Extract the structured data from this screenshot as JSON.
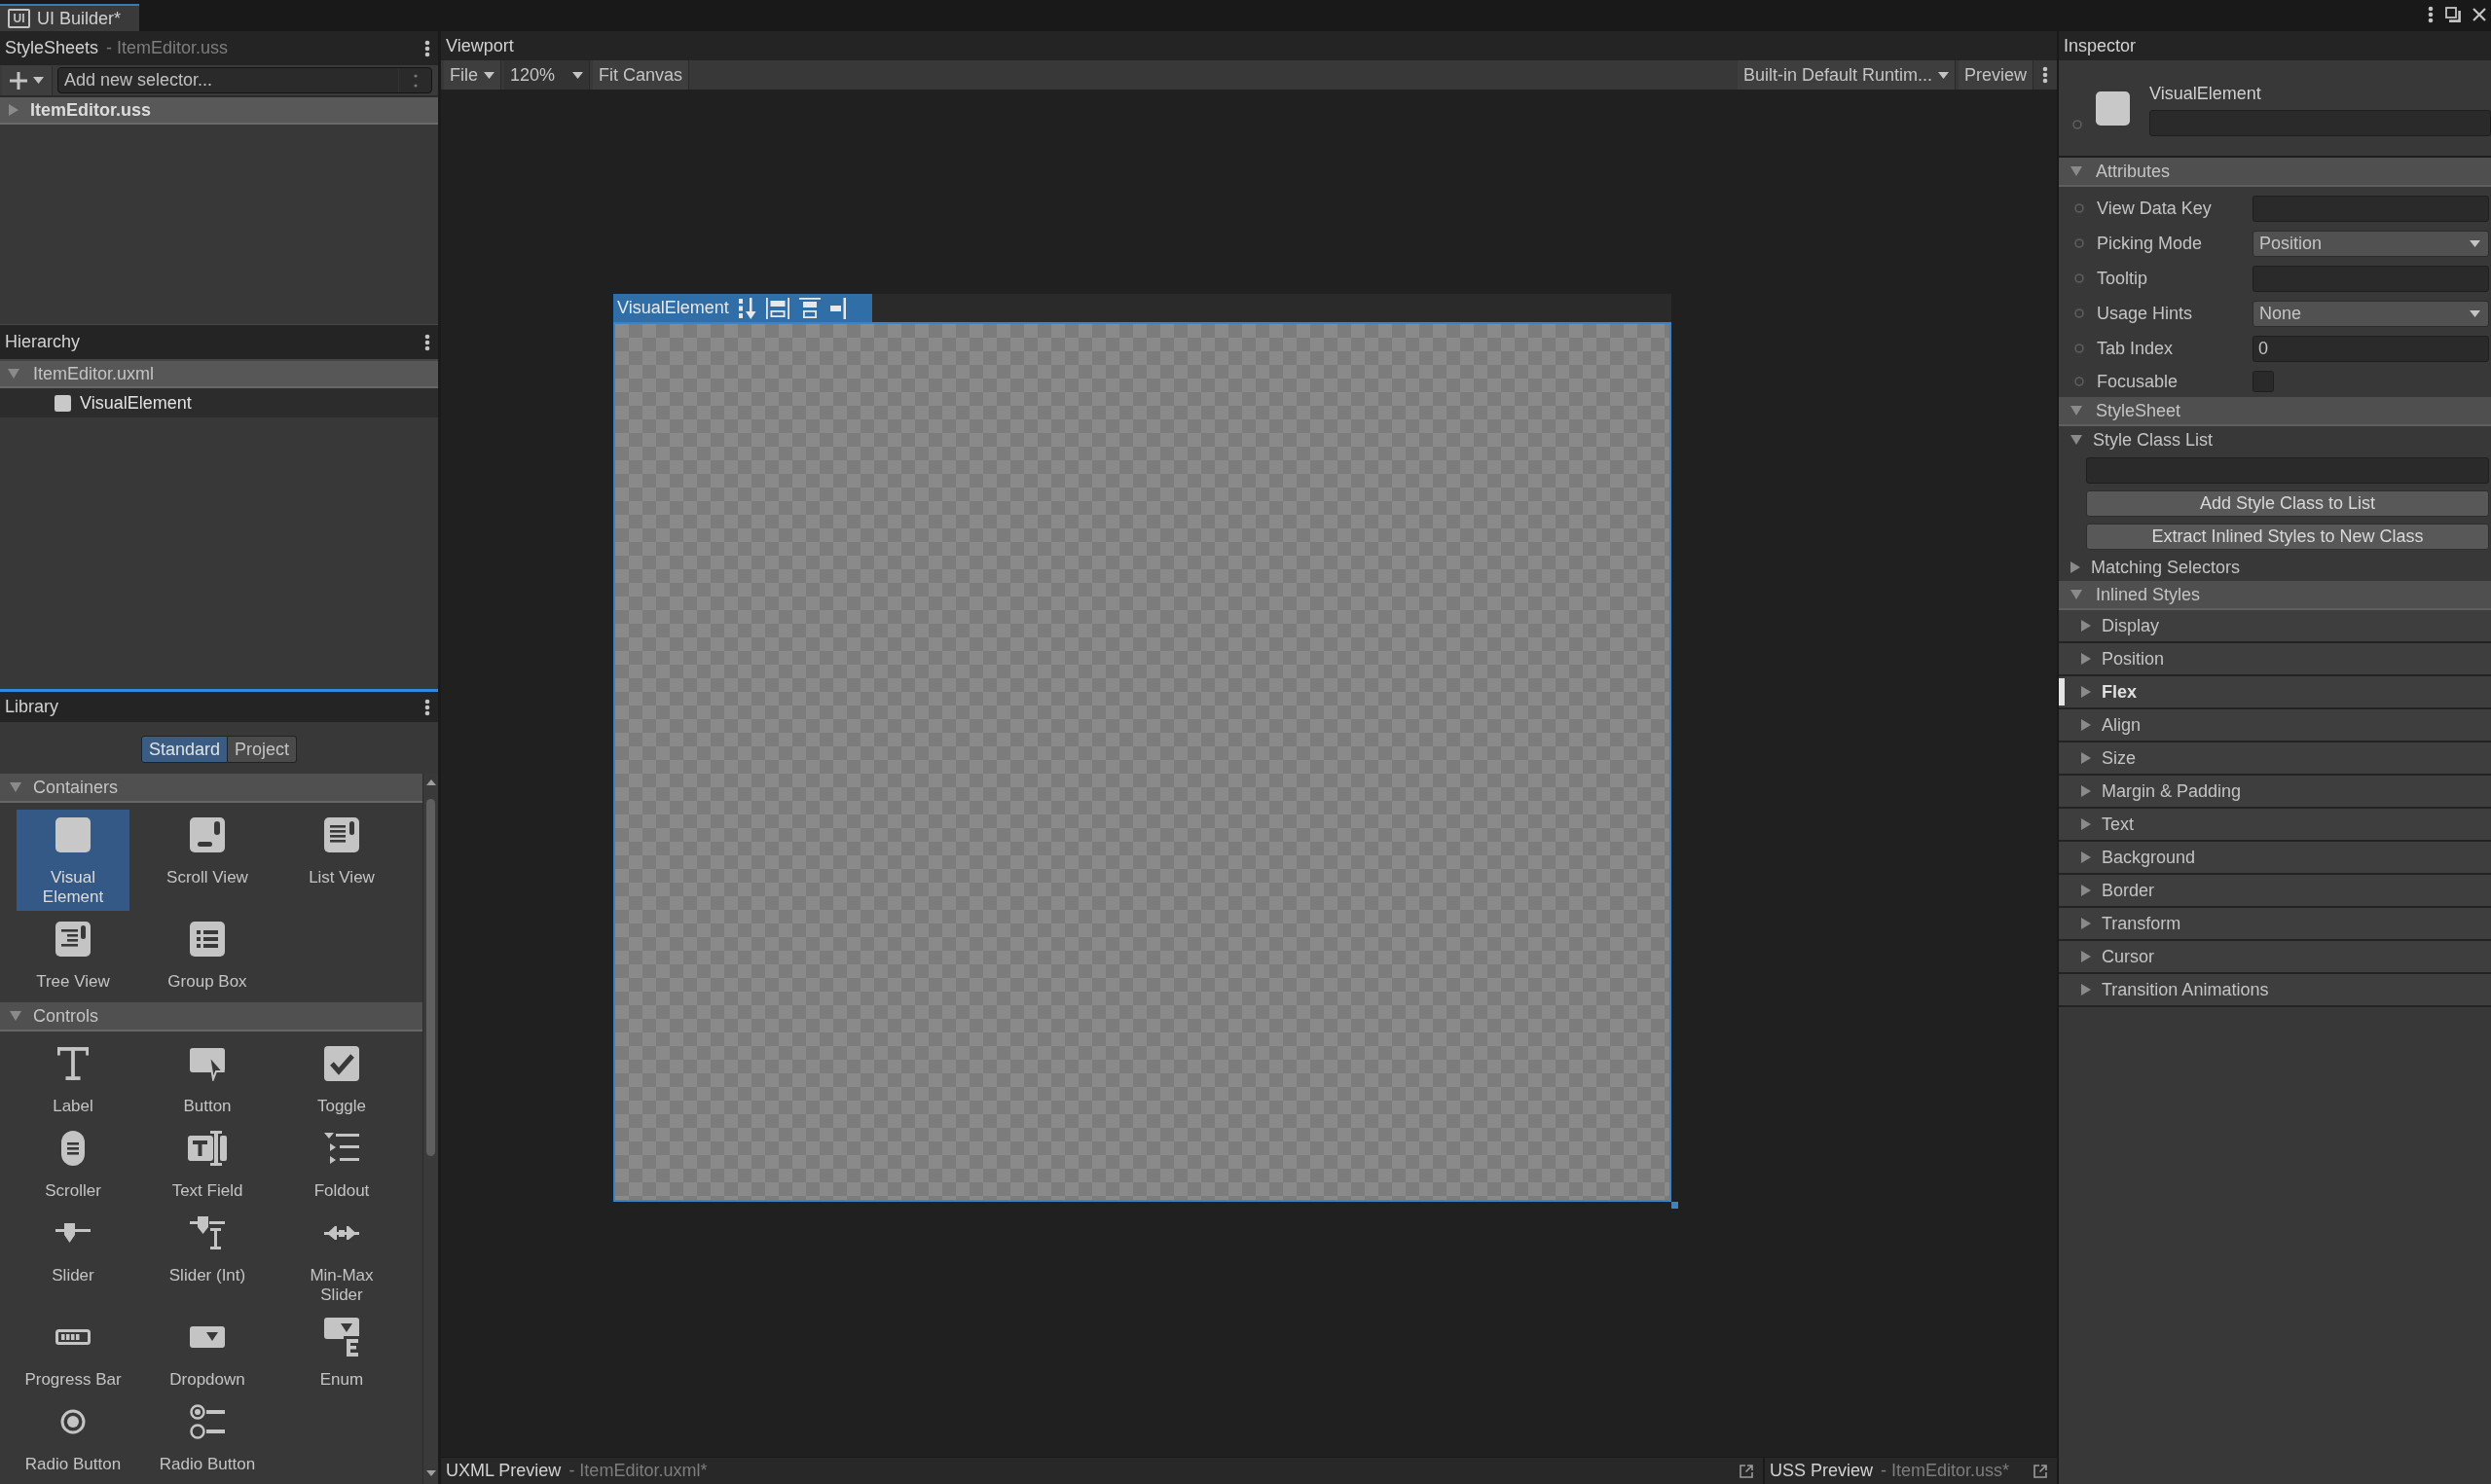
{
  "window": {
    "logo_text": "UI",
    "tab_title": "UI Builder*"
  },
  "stylesheets": {
    "title": "StyleSheets",
    "subtitle": "- ItemEditor.uss",
    "selector_field": {
      "placeholder": "Add new selector..."
    },
    "items": [
      {
        "label": "ItemEditor.uss",
        "expanded": false
      }
    ]
  },
  "hierarchy": {
    "title": "Hierarchy",
    "items": [
      {
        "label": "ItemEditor.uxml",
        "expanded": true,
        "children": [
          {
            "label": "VisualElement",
            "selected": true
          }
        ]
      }
    ]
  },
  "library": {
    "title": "Library",
    "tabs": [
      {
        "label": "Standard",
        "selected": true
      },
      {
        "label": "Project",
        "selected": false
      }
    ],
    "sections": [
      {
        "title": "Containers",
        "expanded": true,
        "items": [
          {
            "label": "Visual Element",
            "kind": "visual-element",
            "selected": true
          },
          {
            "label": "Scroll View",
            "kind": "scroll-view",
            "selected": false
          },
          {
            "label": "List View",
            "kind": "list-view",
            "selected": false
          },
          {
            "label": "Tree View",
            "kind": "tree-view",
            "selected": false
          },
          {
            "label": "Group Box",
            "kind": "group-box",
            "selected": false
          }
        ]
      },
      {
        "title": "Controls",
        "expanded": true,
        "items": [
          {
            "label": "Label",
            "kind": "label",
            "selected": false
          },
          {
            "label": "Button",
            "kind": "button",
            "selected": false
          },
          {
            "label": "Toggle",
            "kind": "toggle",
            "selected": false
          },
          {
            "label": "Scroller",
            "kind": "scroller",
            "selected": false
          },
          {
            "label": "Text Field",
            "kind": "text-field",
            "selected": false
          },
          {
            "label": "Foldout",
            "kind": "foldout",
            "selected": false
          },
          {
            "label": "Slider",
            "kind": "slider",
            "selected": false
          },
          {
            "label": "Slider (Int)",
            "kind": "slider-int",
            "selected": false
          },
          {
            "label": "Min-Max Slider",
            "kind": "min-max-slider",
            "selected": false
          },
          {
            "label": "Progress Bar",
            "kind": "progress-bar",
            "selected": false
          },
          {
            "label": "Dropdown",
            "kind": "dropdown",
            "selected": false
          },
          {
            "label": "Enum",
            "kind": "enum",
            "selected": false
          },
          {
            "label": "Radio Button",
            "kind": "radio-button",
            "selected": false
          },
          {
            "label": "Radio Button",
            "kind": "radio-button-group",
            "selected": false
          }
        ]
      }
    ]
  },
  "viewport": {
    "title": "Viewport",
    "toolbar": {
      "file_menu": "File",
      "zoom_value": "120%",
      "fit_button": "Fit Canvas",
      "theme_dropdown": "Built-in Default Runtim...",
      "preview_button": "Preview"
    },
    "canvas": {
      "element_label": "VisualElement"
    }
  },
  "previews": [
    {
      "title": "UXML Preview",
      "file": "- ItemEditor.uxml*"
    },
    {
      "title": "USS Preview",
      "file": "- ItemEditor.uss*"
    }
  ],
  "inspector": {
    "title": "Inspector",
    "element": {
      "type_label": "VisualElement"
    },
    "attributes": {
      "title": "Attributes",
      "expanded": true,
      "fields": [
        {
          "label": "View Data Key",
          "kind": "text"
        },
        {
          "label": "Picking Mode",
          "kind": "dropdown",
          "value": "Position"
        },
        {
          "label": "Tooltip",
          "kind": "text"
        },
        {
          "label": "Usage Hints",
          "kind": "dropdown",
          "value": "None"
        },
        {
          "label": "Tab Index",
          "kind": "text",
          "value": "0"
        },
        {
          "label": "Focusable",
          "kind": "checkbox",
          "checked": false
        }
      ]
    },
    "stylesheet": {
      "title": "StyleSheet",
      "expanded": true,
      "style_class_list": {
        "title": "Style Class List",
        "expanded": true
      },
      "buttons": [
        "Add Style Class to List",
        "Extract Inlined Styles to New Class"
      ],
      "matching_selectors": {
        "title": "Matching Selectors",
        "expanded": false
      }
    },
    "inlined_styles": {
      "title": "Inlined Styles",
      "expanded": true,
      "groups": [
        {
          "label": "Display",
          "expanded": false,
          "overridden": false
        },
        {
          "label": "Position",
          "expanded": false,
          "overridden": false
        },
        {
          "label": "Flex",
          "expanded": false,
          "overridden": true
        },
        {
          "label": "Align",
          "expanded": false,
          "overridden": false
        },
        {
          "label": "Size",
          "expanded": false,
          "overridden": false
        },
        {
          "label": "Margin & Padding",
          "expanded": false,
          "overridden": false
        },
        {
          "label": "Text",
          "expanded": false,
          "overridden": false
        },
        {
          "label": "Background",
          "expanded": false,
          "overridden": false
        },
        {
          "label": "Border",
          "expanded": false,
          "overridden": false
        },
        {
          "label": "Transform",
          "expanded": false,
          "overridden": false
        },
        {
          "label": "Cursor",
          "expanded": false,
          "overridden": false
        },
        {
          "label": "Transition Animations",
          "expanded": false,
          "overridden": false
        }
      ]
    }
  }
}
